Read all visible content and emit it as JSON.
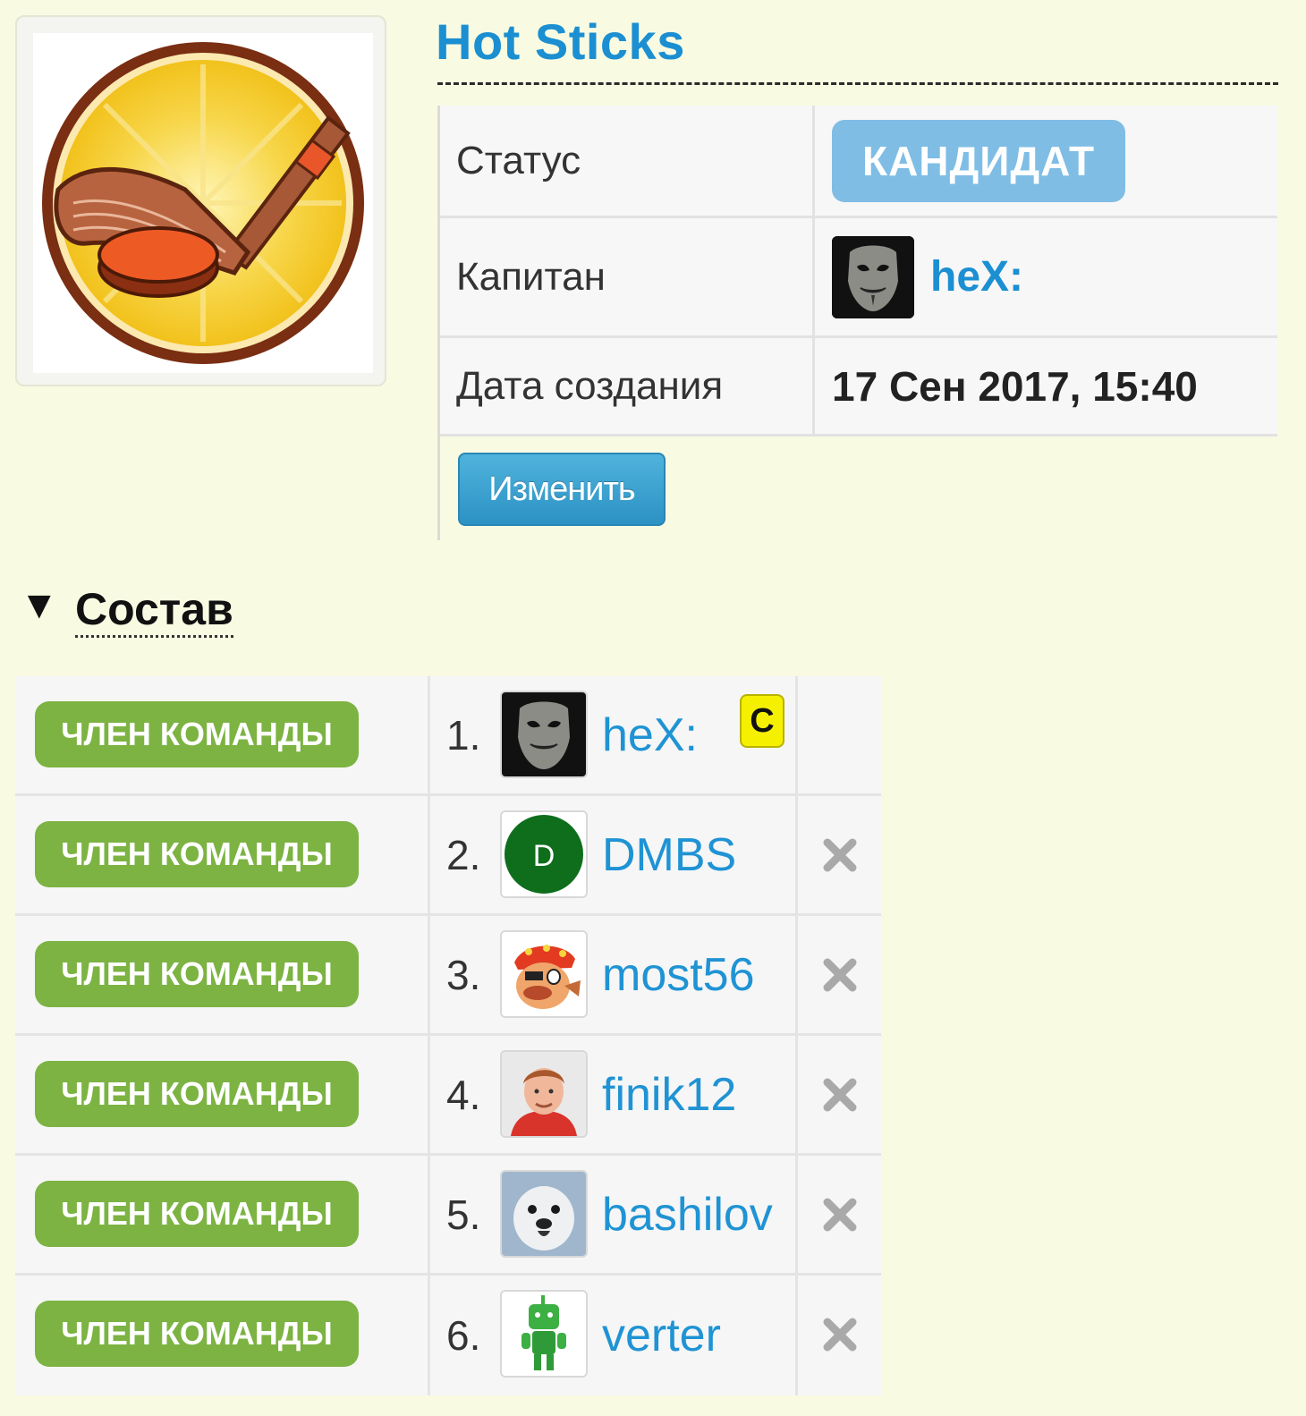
{
  "team": {
    "name": "Hot Sticks",
    "logo_icon": "hockey-stick-and-puck-logo"
  },
  "info": {
    "status_label": "Статус",
    "status_value": "КАНДИДАТ",
    "captain_label": "Капитан",
    "captain_name": "heX:",
    "created_label": "Дата создания",
    "created_value": "17 Сен 2017, 15:40",
    "edit_button": "Изменить"
  },
  "roster": {
    "toggle_glyph": "▼",
    "title": "Состав",
    "captain_mark": "C",
    "members": [
      {
        "role": "ЧЛЕН КОМАНДЫ",
        "index": "1.",
        "name": "heX:",
        "avatar": "mask-avatar"
      },
      {
        "role": "ЧЛЕН КОМАНДЫ",
        "index": "2.",
        "name": "DMBS",
        "avatar": "letter-d-avatar",
        "avatar_letter": "D"
      },
      {
        "role": "ЧЛЕН КОМАНДЫ",
        "index": "3.",
        "name": "most56",
        "avatar": "pirate-cartoon-avatar"
      },
      {
        "role": "ЧЛЕН КОМАНДЫ",
        "index": "4.",
        "name": "finik12",
        "avatar": "man-photo-avatar"
      },
      {
        "role": "ЧЛЕН КОМАНДЫ",
        "index": "5.",
        "name": "bashilov",
        "avatar": "seal-photo-avatar"
      },
      {
        "role": "ЧЛЕН КОМАНДЫ",
        "index": "6.",
        "name": "verter",
        "avatar": "green-robot-avatar"
      }
    ]
  },
  "colors": {
    "page_bg": "#f8fbe2",
    "link": "#1b8fd1",
    "status_badge": "#7fbde5",
    "role_badge": "#7cb342",
    "edit_button": "#2c92c4",
    "captain_mark": "#f5f000"
  }
}
